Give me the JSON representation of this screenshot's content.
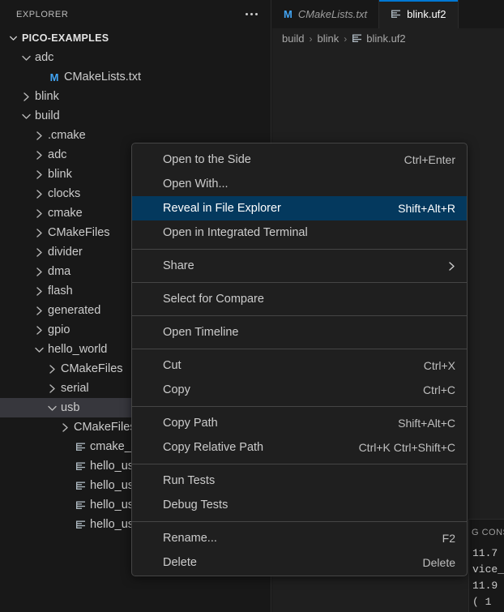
{
  "sidebar": {
    "title": "EXPLORER",
    "more_actions_icon": "ellipsis-icon",
    "tree": [
      {
        "label": "PICO-EXAMPLES",
        "kind": "root",
        "state": "expanded",
        "indent": 0,
        "icon": "chevron-down-icon"
      },
      {
        "label": "adc",
        "kind": "folder",
        "state": "expanded",
        "indent": 1,
        "icon": "chevron-down-icon"
      },
      {
        "label": "CMakeLists.txt",
        "kind": "file",
        "state": "none",
        "indent": 2,
        "icon": "markdown-m-icon"
      },
      {
        "label": "blink",
        "kind": "folder",
        "state": "collapsed",
        "indent": 1,
        "icon": "chevron-right-icon"
      },
      {
        "label": "build",
        "kind": "folder",
        "state": "expanded",
        "indent": 1,
        "icon": "chevron-down-icon"
      },
      {
        "label": ".cmake",
        "kind": "folder",
        "state": "collapsed",
        "indent": 2,
        "icon": "chevron-right-icon"
      },
      {
        "label": "adc",
        "kind": "folder",
        "state": "collapsed",
        "indent": 2,
        "icon": "chevron-right-icon"
      },
      {
        "label": "blink",
        "kind": "folder",
        "state": "collapsed",
        "indent": 2,
        "icon": "chevron-right-icon"
      },
      {
        "label": "clocks",
        "kind": "folder",
        "state": "collapsed",
        "indent": 2,
        "icon": "chevron-right-icon"
      },
      {
        "label": "cmake",
        "kind": "folder",
        "state": "collapsed",
        "indent": 2,
        "icon": "chevron-right-icon"
      },
      {
        "label": "CMakeFiles",
        "kind": "folder",
        "state": "collapsed",
        "indent": 2,
        "icon": "chevron-right-icon"
      },
      {
        "label": "divider",
        "kind": "folder",
        "state": "collapsed",
        "indent": 2,
        "icon": "chevron-right-icon"
      },
      {
        "label": "dma",
        "kind": "folder",
        "state": "collapsed",
        "indent": 2,
        "icon": "chevron-right-icon"
      },
      {
        "label": "flash",
        "kind": "folder",
        "state": "collapsed",
        "indent": 2,
        "icon": "chevron-right-icon"
      },
      {
        "label": "generated",
        "kind": "folder",
        "state": "collapsed",
        "indent": 2,
        "icon": "chevron-right-icon"
      },
      {
        "label": "gpio",
        "kind": "folder",
        "state": "collapsed",
        "indent": 2,
        "icon": "chevron-right-icon"
      },
      {
        "label": "hello_world",
        "kind": "folder",
        "state": "expanded",
        "indent": 2,
        "icon": "chevron-down-icon"
      },
      {
        "label": "CMakeFiles",
        "kind": "folder",
        "state": "collapsed",
        "indent": 3,
        "icon": "chevron-right-icon"
      },
      {
        "label": "serial",
        "kind": "folder",
        "state": "collapsed",
        "indent": 3,
        "icon": "chevron-right-icon"
      },
      {
        "label": "usb",
        "kind": "folder",
        "state": "expanded",
        "indent": 3,
        "icon": "chevron-down-icon",
        "selected": true
      },
      {
        "label": "CMakeFiles",
        "kind": "folder",
        "state": "collapsed",
        "indent": 4,
        "icon": "chevron-right-icon"
      },
      {
        "label": "cmake_insta",
        "kind": "file",
        "state": "none",
        "indent": 4,
        "icon": "text-file-icon"
      },
      {
        "label": "hello_usb.b",
        "kind": "file",
        "state": "none",
        "indent": 4,
        "icon": "text-file-icon"
      },
      {
        "label": "hello_usb.d",
        "kind": "file",
        "state": "none",
        "indent": 4,
        "icon": "text-file-icon"
      },
      {
        "label": "hello_usb.el",
        "kind": "file",
        "state": "none",
        "indent": 4,
        "icon": "text-file-icon"
      },
      {
        "label": "hello_usb.h",
        "kind": "file",
        "state": "none",
        "indent": 4,
        "icon": "text-file-icon"
      }
    ]
  },
  "editor": {
    "tabs": [
      {
        "label": "CMakeLists.txt",
        "icon": "markdown-m-icon",
        "active": false,
        "preview": true
      },
      {
        "label": "blink.uf2",
        "icon": "text-file-icon",
        "active": true,
        "preview": false
      }
    ],
    "breadcrumbs": [
      {
        "label": "build",
        "icon": null
      },
      {
        "label": "blink",
        "icon": null
      },
      {
        "label": "blink.uf2",
        "icon": "text-file-icon"
      }
    ],
    "breadcrumb_separator": "›"
  },
  "panel": {
    "tab_label": "G CONS",
    "lines": [
      "11.7",
      "vice_",
      "11.9",
      "( 1"
    ]
  },
  "context_menu": {
    "groups": [
      {
        "items": [
          {
            "label": "Open to the Side",
            "shortcut": "Ctrl+Enter",
            "highlight": false,
            "submenu": false
          },
          {
            "label": "Open With...",
            "shortcut": "",
            "highlight": false,
            "submenu": false
          },
          {
            "label": "Reveal in File Explorer",
            "shortcut": "Shift+Alt+R",
            "highlight": true,
            "submenu": false
          },
          {
            "label": "Open in Integrated Terminal",
            "shortcut": "",
            "highlight": false,
            "submenu": false
          }
        ]
      },
      {
        "items": [
          {
            "label": "Share",
            "shortcut": "",
            "highlight": false,
            "submenu": true
          }
        ]
      },
      {
        "items": [
          {
            "label": "Select for Compare",
            "shortcut": "",
            "highlight": false,
            "submenu": false
          }
        ]
      },
      {
        "items": [
          {
            "label": "Open Timeline",
            "shortcut": "",
            "highlight": false,
            "submenu": false
          }
        ]
      },
      {
        "items": [
          {
            "label": "Cut",
            "shortcut": "Ctrl+X",
            "highlight": false,
            "submenu": false
          },
          {
            "label": "Copy",
            "shortcut": "Ctrl+C",
            "highlight": false,
            "submenu": false
          }
        ]
      },
      {
        "items": [
          {
            "label": "Copy Path",
            "shortcut": "Shift+Alt+C",
            "highlight": false,
            "submenu": false
          },
          {
            "label": "Copy Relative Path",
            "shortcut": "Ctrl+K Ctrl+Shift+C",
            "highlight": false,
            "submenu": false
          }
        ]
      },
      {
        "items": [
          {
            "label": "Run Tests",
            "shortcut": "",
            "highlight": false,
            "submenu": false
          },
          {
            "label": "Debug Tests",
            "shortcut": "",
            "highlight": false,
            "submenu": false
          }
        ]
      },
      {
        "items": [
          {
            "label": "Rename...",
            "shortcut": "F2",
            "highlight": false,
            "submenu": false
          },
          {
            "label": "Delete",
            "shortcut": "Delete",
            "highlight": false,
            "submenu": false
          }
        ]
      }
    ]
  },
  "colors": {
    "sidebar_bg": "#181818",
    "editor_bg": "#1f1f1f",
    "menu_bg": "#1f1f1f",
    "menu_border": "#454545",
    "highlight_blue": "#04395e",
    "active_tab_border": "#0078d4",
    "row_selected": "#37373d",
    "icon_blue": "#42a5f5"
  }
}
